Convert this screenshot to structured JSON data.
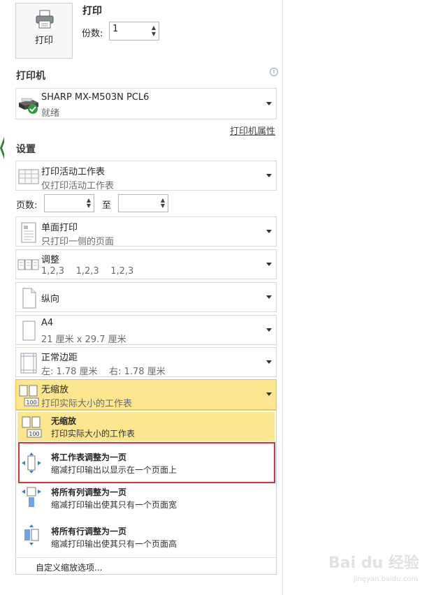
{
  "print": {
    "button_label": "打印",
    "heading": "打印",
    "copies_label": "份数:",
    "copies_value": "1"
  },
  "printer": {
    "section_title": "打印机",
    "name": "SHARP MX-M503N PCL6",
    "status": "就绪",
    "properties_link": "打印机属性"
  },
  "settings": {
    "section_title": "设置",
    "sheets": {
      "title": "打印活动工作表",
      "sub": "仅打印活动工作表"
    },
    "pages_label": "页数:",
    "pages_from": "",
    "pages_to_label": "至",
    "pages_to": "",
    "sides": {
      "title": "单面打印",
      "sub": "只打印一侧的页面"
    },
    "collate": {
      "title": "调整",
      "sub": "1,2,3    1,2,3    1,2,3"
    },
    "orientation": {
      "title": "纵向"
    },
    "paper": {
      "title": "A4",
      "sub": "21 厘米 x 29.7 厘米"
    },
    "margins": {
      "title": "正常边距",
      "sub": "左: 1.78 厘米    右: 1.78 厘米"
    },
    "scaling": {
      "title": "无缩放",
      "sub": "打印实际大小的工作表"
    }
  },
  "scaling_menu": {
    "items": [
      {
        "title": "无缩放",
        "sub": "打印实际大小的工作表"
      },
      {
        "title": "将工作表调整为一页",
        "sub": "缩减打印输出以显示在一个页面上"
      },
      {
        "title": "将所有列调整为一页",
        "sub": "缩减打印输出使其只有一个页面宽"
      },
      {
        "title": "将所有行调整为一页",
        "sub": "缩减打印输出使其只有一个页面高"
      }
    ],
    "custom": "自定义缩放选项..."
  },
  "watermark": {
    "logo": "Bai du 经验",
    "site": "jingyan.baidu.com"
  },
  "colors": {
    "highlight": "#fce68e",
    "selection_box": "#d9333a",
    "ready_green": "#2e9b3d"
  }
}
